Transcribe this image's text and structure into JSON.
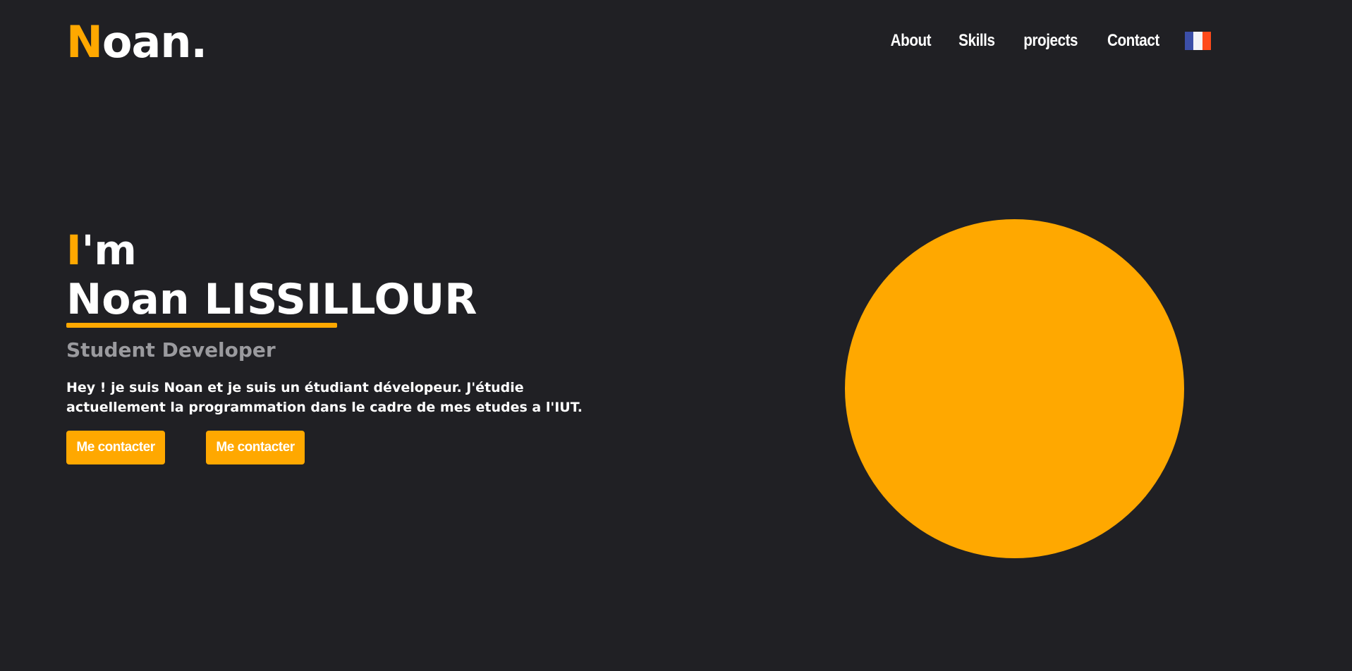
{
  "header": {
    "logo_initial": "N",
    "logo_rest": "oan."
  },
  "nav": {
    "items": [
      {
        "label": "About"
      },
      {
        "label": "Skills"
      },
      {
        "label": "projects"
      },
      {
        "label": "Contact"
      }
    ],
    "language_flag_icon": "france-flag-icon"
  },
  "hero": {
    "im_initial": "I",
    "im_rest": "'m",
    "name": "Noan LISSILLOUR",
    "subtitle": "Student Developer",
    "intro": "Hey ! je suis Noan et je suis un étudiant dévelopeur. J'étudie actuellement la programmation dans le cadre de mes etudes a l'IUT.",
    "buttons": [
      {
        "label": "Me contacter"
      },
      {
        "label": "Me contacter"
      }
    ]
  },
  "colors": {
    "background": "#202024",
    "accent": "#ffa800",
    "text": "#ffffff",
    "muted": "#9a9a9e",
    "flag_blue": "#3c4fa8",
    "flag_white": "#f4f4f8",
    "flag_red": "#ff4a1a"
  }
}
